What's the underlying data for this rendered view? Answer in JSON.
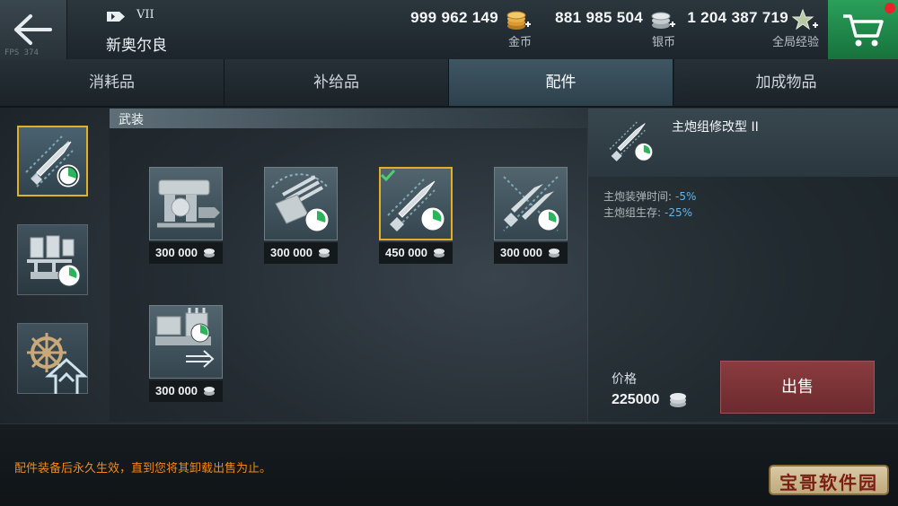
{
  "header": {
    "ship_tier": "VII",
    "ship_name": "新奥尔良",
    "fps": "FPS 374",
    "currencies": [
      {
        "amount": "999 962 149",
        "label": "金币",
        "icon": "gold-coins-plus-icon"
      },
      {
        "amount": "881 985 504",
        "label": "银币",
        "icon": "silver-coins-plus-icon"
      },
      {
        "amount": "1 204 387 719",
        "label": "全局经验",
        "icon": "global-xp-star-plus-icon"
      }
    ]
  },
  "tabs": [
    {
      "label": "消耗品",
      "active": false
    },
    {
      "label": "补给品",
      "active": false
    },
    {
      "label": "配件",
      "active": true
    },
    {
      "label": "加成物品",
      "active": false
    }
  ],
  "sidebar": {
    "categories": [
      {
        "name": "armament-category",
        "icon": "shell-timer-icon",
        "active": true
      },
      {
        "name": "engine-category",
        "icon": "engine-timer-icon",
        "active": false
      },
      {
        "name": "maneuver-category",
        "icon": "helm-wheel-icon",
        "active": false
      }
    ]
  },
  "section": {
    "title": "武装"
  },
  "items": [
    {
      "icon": "aa-gun-mount-icon",
      "price": "300 000",
      "selected": false
    },
    {
      "icon": "main-turret-timer-icon",
      "price": "300 000",
      "selected": false
    },
    {
      "icon": "main-battery-mod-icon",
      "price": "450 000",
      "selected": true
    },
    {
      "icon": "torpedo-mod-icon",
      "price": "300 000",
      "selected": false
    },
    {
      "icon": "secondary-battery-icon",
      "price": "300 000",
      "selected": false
    }
  ],
  "detail": {
    "name": "主炮组修改型 II",
    "stats": [
      {
        "label": "主炮装弹时间:",
        "value": "-5%"
      },
      {
        "label": "主炮组生存:",
        "value": "-25%"
      }
    ],
    "price_label": "价格",
    "price_value": "225000",
    "sell_label": "出售"
  },
  "footer": {
    "note": "配件装备后永久生效，直到您将其卸载出售为止。"
  },
  "watermark": {
    "text": "宝哥软件园"
  },
  "colors": {
    "accent_gold": "#e2b021",
    "stat_blue": "#62b6f0",
    "sell_red": "#7c3336",
    "cart_green": "#1f8a4a",
    "note_orange": "#f08a1a"
  }
}
